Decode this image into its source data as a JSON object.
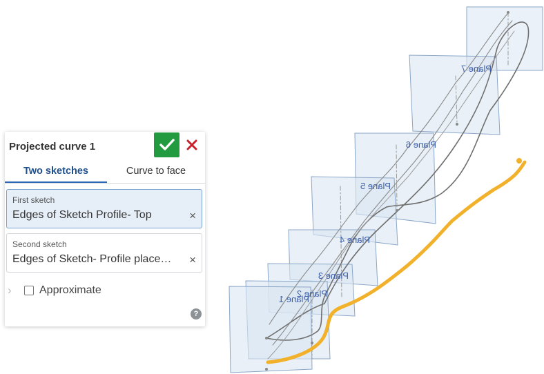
{
  "panel": {
    "title": "Projected curve 1",
    "ok_icon": "checkmark-icon",
    "cancel_icon": "close-icon",
    "tabs": [
      {
        "label": "Two sketches",
        "active": true
      },
      {
        "label": "Curve to face",
        "active": false
      }
    ],
    "first_sketch": {
      "label": "First sketch",
      "value": "Edges of Sketch Profile- Top"
    },
    "second_sketch": {
      "label": "Second sketch",
      "value": "Edges of Sketch- Profile placement"
    },
    "approximate_label": "Approximate",
    "approximate_checked": false,
    "help_glyph": "?"
  },
  "viewport": {
    "planes": [
      "Plane 1",
      "Plane 2",
      "Plane 3",
      "Plane 4",
      "Plane 5",
      "Plane 6",
      "Plane 7"
    ],
    "colors": {
      "plane_fill": "#dbe6f2",
      "plane_edge": "#8aa6c8",
      "plane_label": "#3d5ea8",
      "sketch_curve": "#7c7c7c",
      "projected_curve": "#f2b12b"
    }
  },
  "colors": {
    "accent": "#2b67b3",
    "ok": "#219a40",
    "cancel": "#c8202a",
    "field_selected_bg": "#e6eef7"
  }
}
